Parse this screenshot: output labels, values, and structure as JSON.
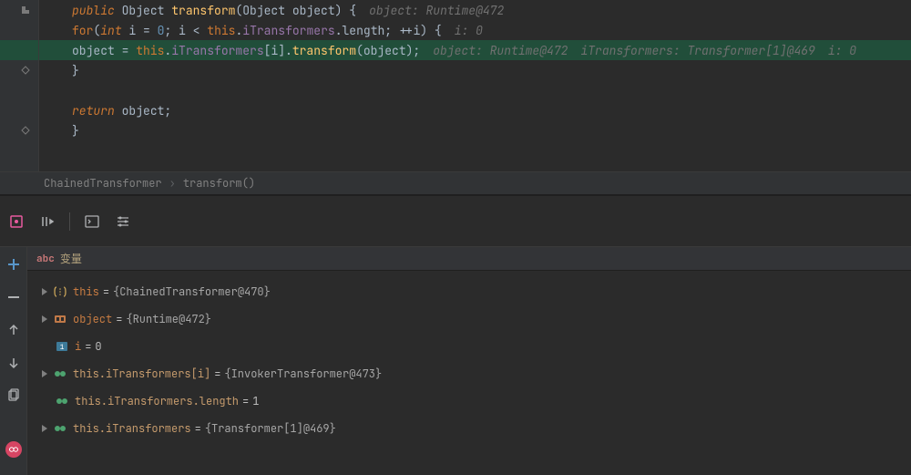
{
  "code": {
    "line1": {
      "sig_public": "public",
      "sig_ret": " Object ",
      "sig_name": "transform",
      "sig_open": "(",
      "sig_ptype": "Object ",
      "sig_pname": "object",
      "sig_close": ") {",
      "inlay": "object: Runtime@472"
    },
    "line2": {
      "for_kw": "for",
      "open": "(",
      "int_kw": "int",
      "decl": " i = ",
      "zero": "0",
      "semi1": "; i < ",
      "this": "this",
      "dot": ".",
      "field": "iTransformers",
      "len": ".length; ++i) {",
      "inlay": "i: 0"
    },
    "line3": {
      "assign_lhs": "object = ",
      "this": "this",
      "dot": ".",
      "field": "iTransformers",
      "idx": "[i].",
      "method": "transform",
      "call": "(object);",
      "inlay1": "object: Runtime@472",
      "inlay2": "iTransformers: Transformer[1]@469",
      "inlay3": "i: 0"
    },
    "line4": {
      "brace": "}"
    },
    "line6": {
      "ret": "return",
      "obj": " object;"
    },
    "line7": {
      "brace": "}"
    }
  },
  "breadcrumb": {
    "a": "ChainedTransformer",
    "sep": "›",
    "b": "transform()"
  },
  "vars_header": {
    "abc": "abc",
    "label": "变量"
  },
  "vars": {
    "this": {
      "name": "this",
      "val": "{ChainedTransformer@470}"
    },
    "object": {
      "name": "object",
      "val": "{Runtime@472}"
    },
    "i": {
      "name": "i",
      "val": "0"
    },
    "it_i": {
      "name": "this.iTransformers[i]",
      "val": "{InvokerTransformer@473}"
    },
    "it_len": {
      "name": "this.iTransformers.length",
      "val": "1"
    },
    "it": {
      "name": "this.iTransformers",
      "val": "{Transformer[1]@469}"
    }
  }
}
